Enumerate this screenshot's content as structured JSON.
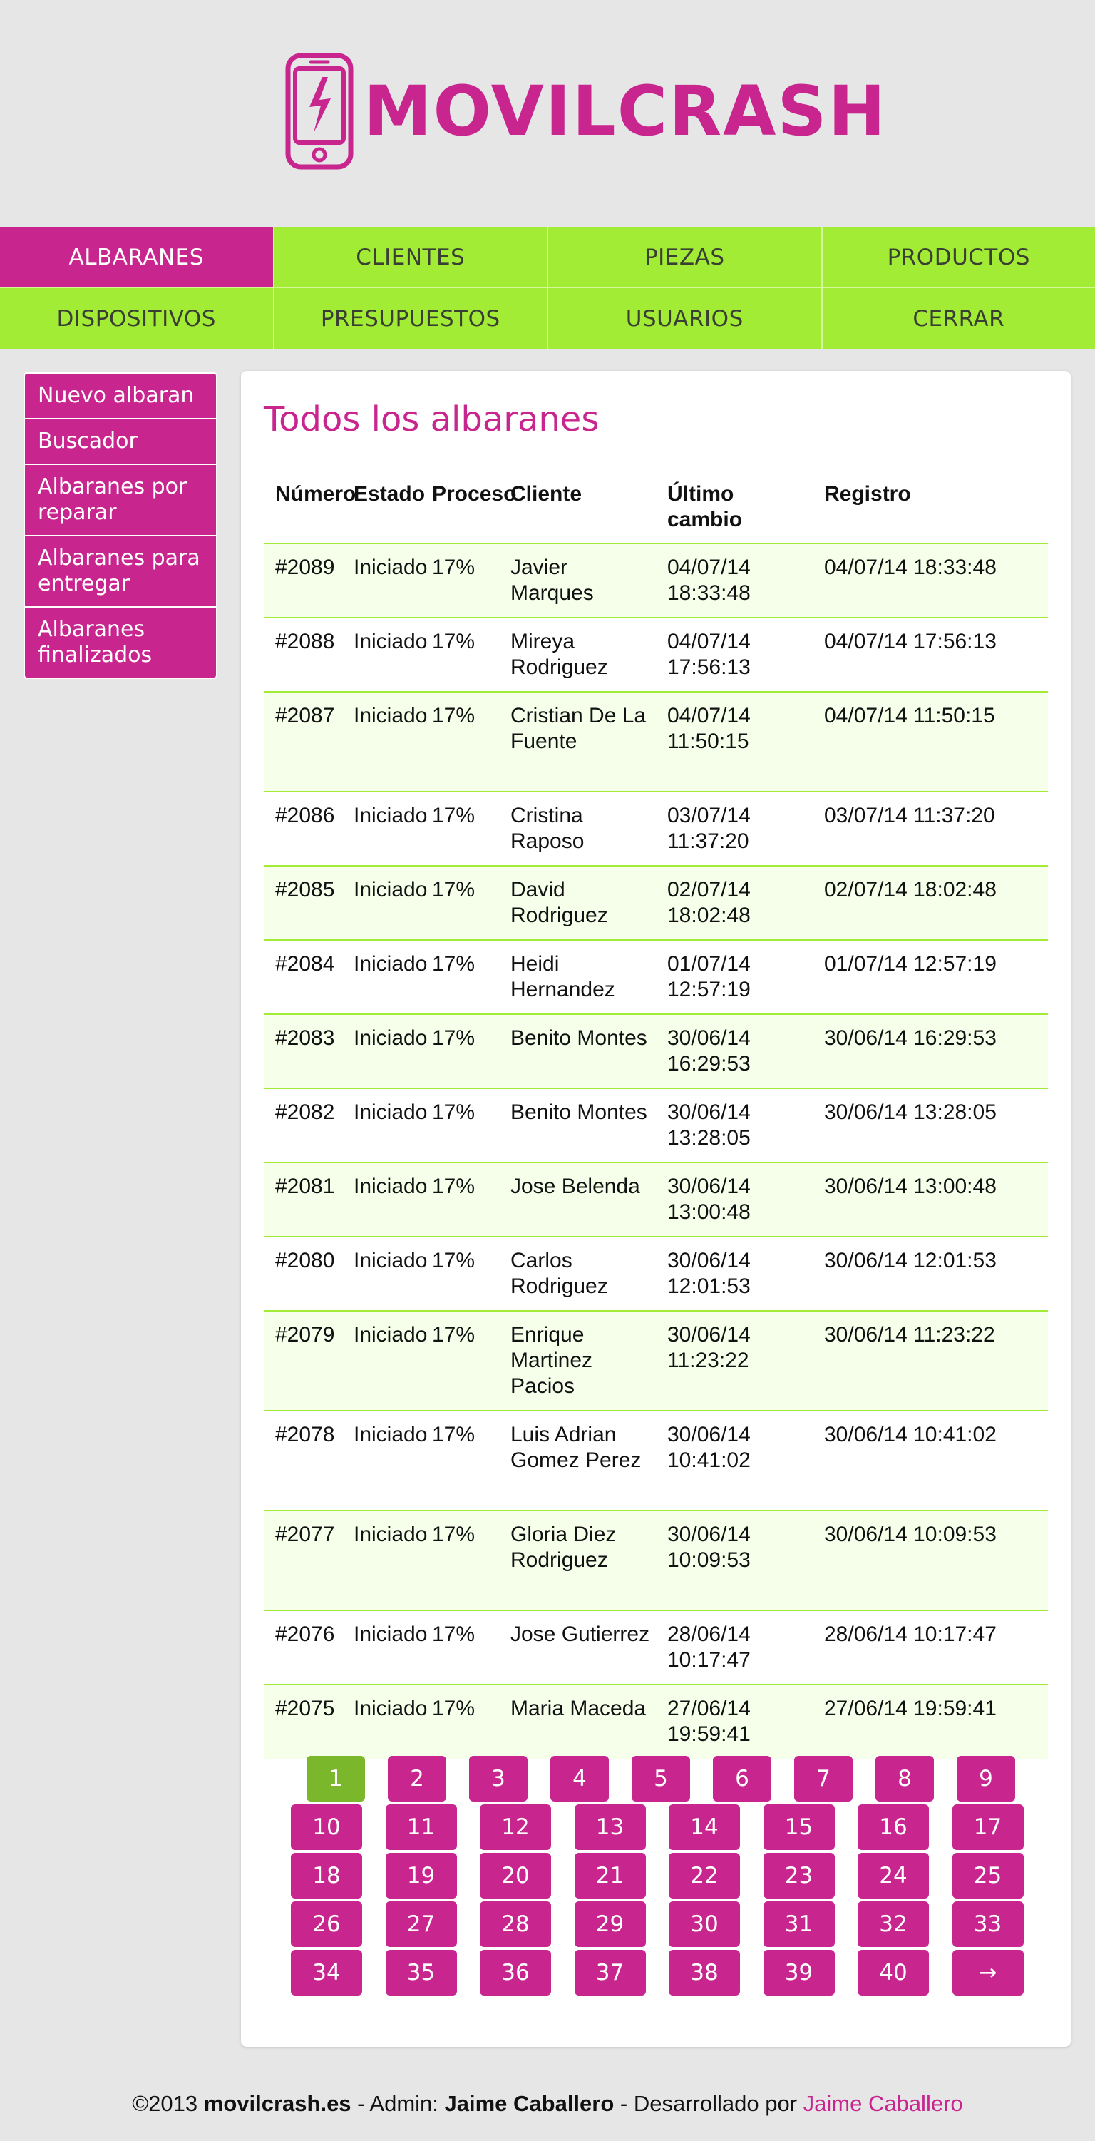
{
  "brand": {
    "name": "MOVILCRASH",
    "icon": "phone-lightning-icon",
    "color": "#c8258f"
  },
  "nav": {
    "row1": [
      "ALBARANES",
      "CLIENTES",
      "PIEZAS",
      "PRODUCTOS"
    ],
    "row2": [
      "DISPOSITIVOS",
      "PRESUPUESTOS",
      "USUARIOS",
      "CERRAR"
    ],
    "active": "ALBARANES",
    "accent": "#a3ec35"
  },
  "sidebar": [
    "Nuevo albaran",
    "Buscador",
    "Albaranes por reparar",
    "Albaranes para entregar",
    "Albaranes finalizados"
  ],
  "main": {
    "title": "Todos los albaranes",
    "columns": [
      "Número",
      "Estado",
      "Proceso",
      "Cliente",
      "Último cambio",
      "Registro"
    ],
    "rows": [
      {
        "num": "#2089",
        "estado": "Iniciado",
        "proceso": "17%",
        "cliente": "Javier Marques",
        "ultimo": "04/07/14 18:33:48",
        "registro": "04/07/14 18:33:48"
      },
      {
        "num": "#2088",
        "estado": "Iniciado",
        "proceso": "17%",
        "cliente": "Mireya Rodriguez",
        "ultimo": "04/07/14 17:56:13",
        "registro": "04/07/14 17:56:13"
      },
      {
        "num": "#2087",
        "estado": "Iniciado",
        "proceso": "17%",
        "cliente": "Cristian De La Fuente",
        "ultimo": "04/07/14 11:50:15",
        "registro": "04/07/14 11:50:15"
      },
      {
        "num": "#2086",
        "estado": "Iniciado",
        "proceso": "17%",
        "cliente": "Cristina Raposo",
        "ultimo": "03/07/14 11:37:20",
        "registro": "03/07/14 11:37:20"
      },
      {
        "num": "#2085",
        "estado": "Iniciado",
        "proceso": "17%",
        "cliente": "David Rodriguez",
        "ultimo": "02/07/14 18:02:48",
        "registro": "02/07/14 18:02:48"
      },
      {
        "num": "#2084",
        "estado": "Iniciado",
        "proceso": "17%",
        "cliente": "Heidi Hernandez",
        "ultimo": "01/07/14 12:57:19",
        "registro": "01/07/14 12:57:19"
      },
      {
        "num": "#2083",
        "estado": "Iniciado",
        "proceso": "17%",
        "cliente": "Benito Montes",
        "ultimo": "30/06/14 16:29:53",
        "registro": "30/06/14 16:29:53"
      },
      {
        "num": "#2082",
        "estado": "Iniciado",
        "proceso": "17%",
        "cliente": "Benito Montes",
        "ultimo": "30/06/14 13:28:05",
        "registro": "30/06/14 13:28:05"
      },
      {
        "num": "#2081",
        "estado": "Iniciado",
        "proceso": "17%",
        "cliente": "Jose Belenda",
        "ultimo": "30/06/14 13:00:48",
        "registro": "30/06/14 13:00:48"
      },
      {
        "num": "#2080",
        "estado": "Iniciado",
        "proceso": "17%",
        "cliente": "Carlos Rodriguez",
        "ultimo": "30/06/14 12:01:53",
        "registro": "30/06/14 12:01:53"
      },
      {
        "num": "#2079",
        "estado": "Iniciado",
        "proceso": "17%",
        "cliente": "Enrique Martinez Pacios",
        "ultimo": "30/06/14 11:23:22",
        "registro": "30/06/14 11:23:22"
      },
      {
        "num": "#2078",
        "estado": "Iniciado",
        "proceso": "17%",
        "cliente": "Luis Adrian Gomez Perez",
        "ultimo": "30/06/14 10:41:02",
        "registro": "30/06/14 10:41:02"
      },
      {
        "num": "#2077",
        "estado": "Iniciado",
        "proceso": "17%",
        "cliente": "Gloria Diez Rodriguez",
        "ultimo": "30/06/14 10:09:53",
        "registro": "30/06/14 10:09:53"
      },
      {
        "num": "#2076",
        "estado": "Iniciado",
        "proceso": "17%",
        "cliente": "Jose Gutierrez",
        "ultimo": "28/06/14 10:17:47",
        "registro": "28/06/14 10:17:47"
      },
      {
        "num": "#2075",
        "estado": "Iniciado",
        "proceso": "17%",
        "cliente": "Maria Maceda",
        "ultimo": "27/06/14 19:59:41",
        "registro": "27/06/14 19:59:41"
      }
    ]
  },
  "pagination": {
    "current": "1",
    "rows": [
      [
        "1",
        "2",
        "3",
        "4",
        "5",
        "6",
        "7",
        "8",
        "9"
      ],
      [
        "10",
        "11",
        "12",
        "13",
        "14",
        "15",
        "16",
        "17"
      ],
      [
        "18",
        "19",
        "20",
        "21",
        "22",
        "23",
        "24",
        "25"
      ],
      [
        "26",
        "27",
        "28",
        "29",
        "30",
        "31",
        "32",
        "33"
      ],
      [
        "34",
        "35",
        "36",
        "37",
        "38",
        "39",
        "40",
        "→"
      ]
    ]
  },
  "footer": {
    "copyright": "©2013 ",
    "site": "movilcrash.es",
    "admin_prefix": " - Admin: ",
    "admin": "Jaime Caballero",
    "dev_prefix": " - Desarrollado por ",
    "dev": "Jaime Caballero"
  }
}
